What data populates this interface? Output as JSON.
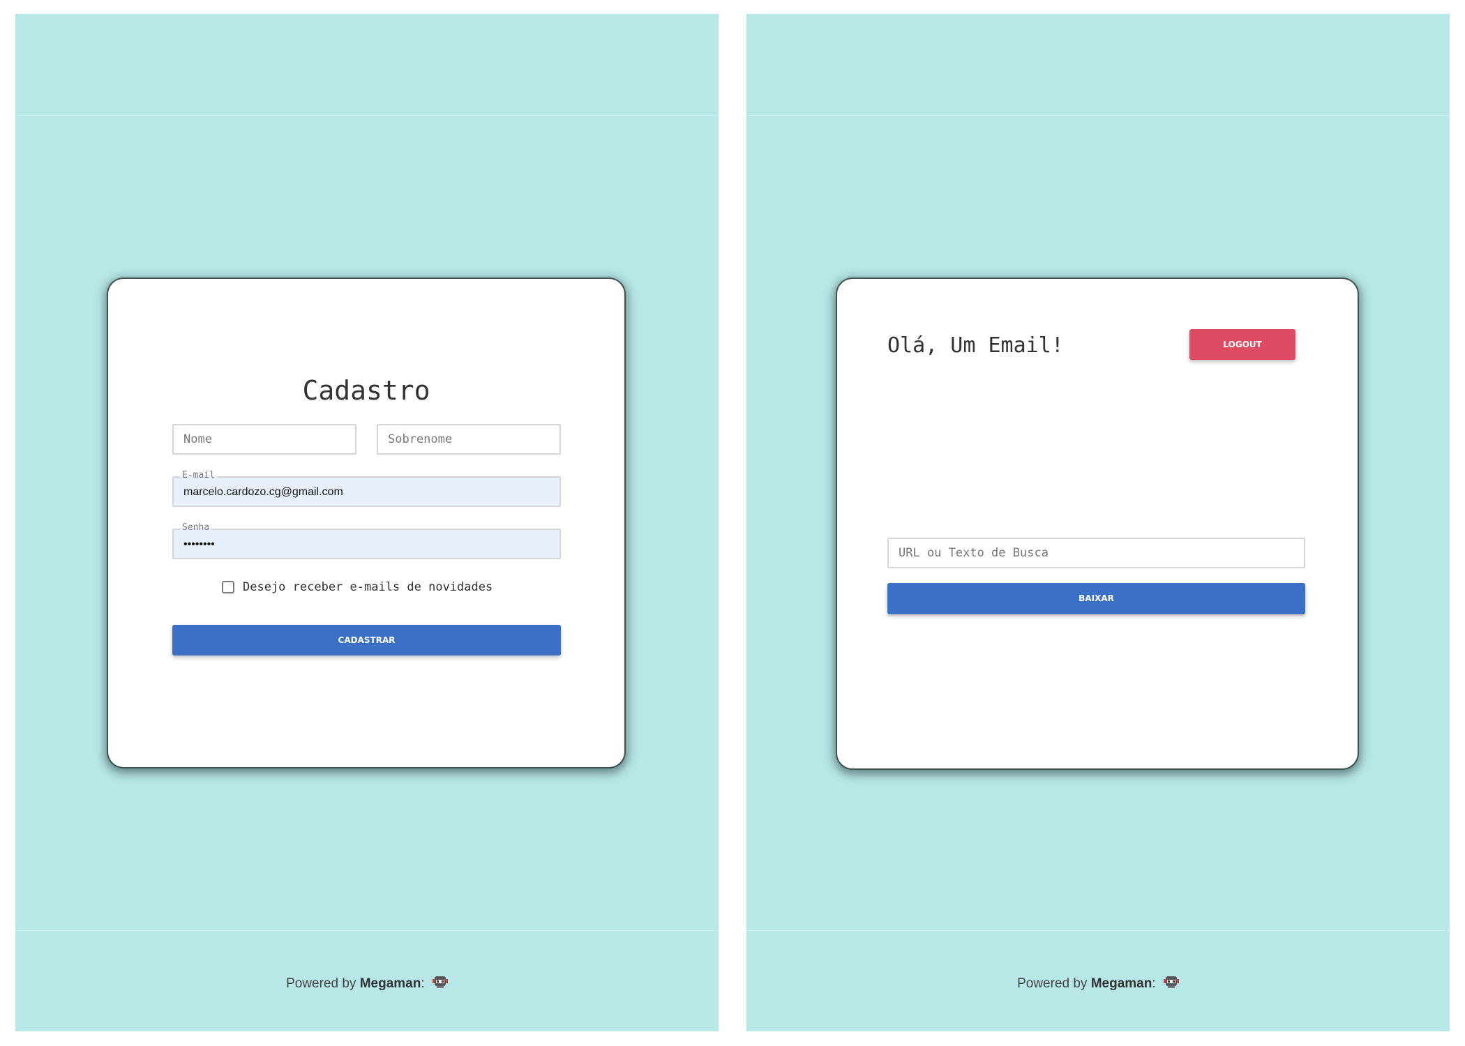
{
  "left": {
    "title": "Cadastro",
    "fields": {
      "first_name_placeholder": "Nome",
      "last_name_placeholder": "Sobrenome",
      "email_label": "E-mail",
      "email_value": "marcelo.cardozo.cg@gmail.com",
      "password_label": "Senha",
      "password_value": "••••••••"
    },
    "newsletter_label": "Desejo receber e-mails de novidades",
    "submit_label": "CADASTRAR"
  },
  "right": {
    "greeting": "Olá, Um Email!",
    "logout_label": "LOGOUT",
    "search_placeholder": "URL ou Texto de Busca",
    "download_label": "BAIXAR"
  },
  "footer": {
    "prefix": "Powered by",
    "brand": "Megaman",
    "suffix": ":"
  },
  "colors": {
    "background": "#b7e7e6",
    "primary": "#3b70c8",
    "danger": "#de4b62",
    "autofill": "#e8f0fe"
  },
  "icons": {
    "footer_icon": "megaman-robot-icon"
  }
}
